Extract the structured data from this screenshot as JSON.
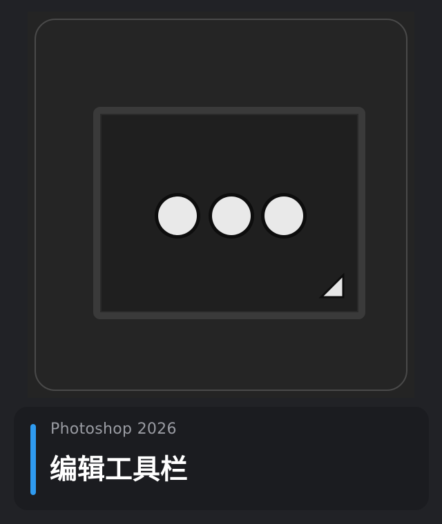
{
  "caption": {
    "app_name": "Photoshop 2026",
    "tool_name": "编辑工具栏"
  },
  "icon": {
    "name": "edit-toolbar-icon",
    "dot_count": 3
  },
  "colors": {
    "accent": "#2f9bf0",
    "subtitle": "#9a9ca3",
    "title": "#ffffff",
    "dot": "#e9e9e9"
  }
}
